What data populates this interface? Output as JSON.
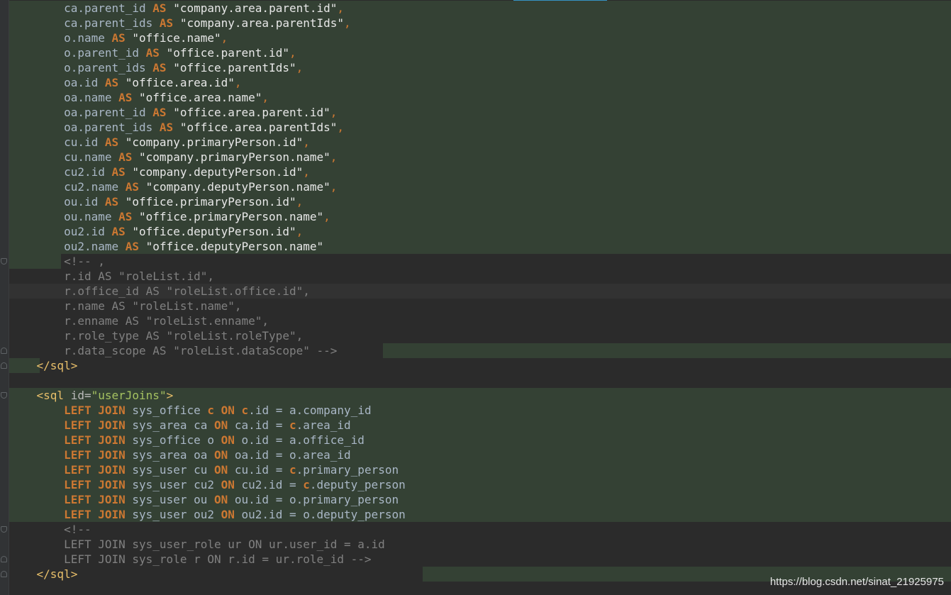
{
  "editor": {
    "lines": [
      {
        "segs": [
          [
            "id",
            "        ca.parent_id "
          ],
          [
            "kw",
            "AS"
          ],
          [
            "id",
            " "
          ],
          [
            "str",
            "\"company.area.parent.id\""
          ],
          [
            "comma",
            ","
          ]
        ]
      },
      {
        "segs": [
          [
            "id",
            "        ca.parent_ids "
          ],
          [
            "kw",
            "AS"
          ],
          [
            "id",
            " "
          ],
          [
            "str",
            "\"company.area.parentIds\""
          ],
          [
            "comma",
            ","
          ]
        ]
      },
      {
        "segs": [
          [
            "id",
            "        o.name "
          ],
          [
            "kw",
            "AS"
          ],
          [
            "id",
            " "
          ],
          [
            "str",
            "\"office.name\""
          ],
          [
            "comma",
            ","
          ]
        ]
      },
      {
        "segs": [
          [
            "id",
            "        o.parent_id "
          ],
          [
            "kw",
            "AS"
          ],
          [
            "id",
            " "
          ],
          [
            "str",
            "\"office.parent.id\""
          ],
          [
            "comma",
            ","
          ]
        ]
      },
      {
        "segs": [
          [
            "id",
            "        o.parent_ids "
          ],
          [
            "kw",
            "AS"
          ],
          [
            "id",
            " "
          ],
          [
            "str",
            "\"office.parentIds\""
          ],
          [
            "comma",
            ","
          ]
        ]
      },
      {
        "segs": [
          [
            "id",
            "        oa.id "
          ],
          [
            "kw",
            "AS"
          ],
          [
            "id",
            " "
          ],
          [
            "str",
            "\"office.area.id\""
          ],
          [
            "comma",
            ","
          ]
        ]
      },
      {
        "segs": [
          [
            "id",
            "        oa.name "
          ],
          [
            "kw",
            "AS"
          ],
          [
            "id",
            " "
          ],
          [
            "str",
            "\"office.area.name\""
          ],
          [
            "comma",
            ","
          ]
        ]
      },
      {
        "segs": [
          [
            "id",
            "        oa.parent_id "
          ],
          [
            "kw",
            "AS"
          ],
          [
            "id",
            " "
          ],
          [
            "str",
            "\"office.area.parent.id\""
          ],
          [
            "comma",
            ","
          ]
        ]
      },
      {
        "segs": [
          [
            "id",
            "        oa.parent_ids "
          ],
          [
            "kw",
            "AS"
          ],
          [
            "id",
            " "
          ],
          [
            "str",
            "\"office.area.parentIds\""
          ],
          [
            "comma",
            ","
          ]
        ]
      },
      {
        "segs": [
          [
            "id",
            "        cu.id "
          ],
          [
            "kw",
            "AS"
          ],
          [
            "id",
            " "
          ],
          [
            "str",
            "\"company.primaryPerson.id\""
          ],
          [
            "comma",
            ","
          ]
        ]
      },
      {
        "segs": [
          [
            "id",
            "        cu.name "
          ],
          [
            "kw",
            "AS"
          ],
          [
            "id",
            " "
          ],
          [
            "str",
            "\"company.primaryPerson.name\""
          ],
          [
            "comma",
            ","
          ]
        ]
      },
      {
        "segs": [
          [
            "id",
            "        cu2.id "
          ],
          [
            "kw",
            "AS"
          ],
          [
            "id",
            " "
          ],
          [
            "str",
            "\"company.deputyPerson.id\""
          ],
          [
            "comma",
            ","
          ]
        ]
      },
      {
        "segs": [
          [
            "id",
            "        cu2.name "
          ],
          [
            "kw",
            "AS"
          ],
          [
            "id",
            " "
          ],
          [
            "str",
            "\"company.deputyPerson.name\""
          ],
          [
            "comma",
            ","
          ]
        ]
      },
      {
        "segs": [
          [
            "id",
            "        ou.id "
          ],
          [
            "kw",
            "AS"
          ],
          [
            "id",
            " "
          ],
          [
            "str",
            "\"office.primaryPerson.id\""
          ],
          [
            "comma",
            ","
          ]
        ]
      },
      {
        "segs": [
          [
            "id",
            "        ou.name "
          ],
          [
            "kw",
            "AS"
          ],
          [
            "id",
            " "
          ],
          [
            "str",
            "\"office.primaryPerson.name\""
          ],
          [
            "comma",
            ","
          ]
        ]
      },
      {
        "segs": [
          [
            "id",
            "        ou2.id "
          ],
          [
            "kw",
            "AS"
          ],
          [
            "id",
            " "
          ],
          [
            "str",
            "\"office.deputyPerson.id\""
          ],
          [
            "comma",
            ","
          ]
        ]
      },
      {
        "segs": [
          [
            "id",
            "        ou2.name "
          ],
          [
            "kw",
            "AS"
          ],
          [
            "id",
            " "
          ],
          [
            "str",
            "\"office.deputyPerson.name\""
          ]
        ]
      },
      {
        "segs": [
          [
            "comment",
            "        <!-- ,"
          ]
        ]
      },
      {
        "segs": [
          [
            "comment",
            "        r.id AS \"roleList.id\","
          ]
        ]
      },
      {
        "segs": [
          [
            "comment",
            "        r.office_id AS \"roleList.office.id\","
          ]
        ]
      },
      {
        "segs": [
          [
            "comment",
            "        r.name AS \"roleList.name\","
          ]
        ]
      },
      {
        "segs": [
          [
            "comment",
            "        r.enname AS \"roleList.enname\","
          ]
        ]
      },
      {
        "segs": [
          [
            "comment",
            "        r.role_type AS \"roleList.roleType\","
          ]
        ]
      },
      {
        "segs": [
          [
            "comment",
            "        r.data_scope AS \"roleList.dataScope\" -->"
          ]
        ]
      },
      {
        "segs": [
          [
            "id",
            "    "
          ],
          [
            "tag",
            "</sql>"
          ]
        ]
      },
      {
        "segs": []
      },
      {
        "segs": [
          [
            "id",
            "    "
          ],
          [
            "tag",
            "<sql "
          ],
          [
            "attr",
            "id="
          ],
          [
            "attrval",
            "\"userJoins\""
          ],
          [
            "tag",
            ">"
          ]
        ]
      },
      {
        "segs": [
          [
            "id",
            "        "
          ],
          [
            "kw",
            "LEFT JOIN"
          ],
          [
            "id",
            " sys_office "
          ],
          [
            "kw",
            "c"
          ],
          [
            "id",
            " "
          ],
          [
            "kw",
            "ON"
          ],
          [
            "id",
            " "
          ],
          [
            "kw",
            "c"
          ],
          [
            "id",
            ".id = a.company_id"
          ]
        ]
      },
      {
        "segs": [
          [
            "id",
            "        "
          ],
          [
            "kw",
            "LEFT JOIN"
          ],
          [
            "id",
            " sys_area ca "
          ],
          [
            "kw",
            "ON"
          ],
          [
            "id",
            " ca.id = "
          ],
          [
            "kw",
            "c"
          ],
          [
            "id",
            ".area_id"
          ]
        ]
      },
      {
        "segs": [
          [
            "id",
            "        "
          ],
          [
            "kw",
            "LEFT JOIN"
          ],
          [
            "id",
            " sys_office o "
          ],
          [
            "kw",
            "ON"
          ],
          [
            "id",
            " o.id = a.office_id"
          ]
        ]
      },
      {
        "segs": [
          [
            "id",
            "        "
          ],
          [
            "kw",
            "LEFT JOIN"
          ],
          [
            "id",
            " sys_area oa "
          ],
          [
            "kw",
            "ON"
          ],
          [
            "id",
            " oa.id = o.area_id"
          ]
        ]
      },
      {
        "segs": [
          [
            "id",
            "        "
          ],
          [
            "kw",
            "LEFT JOIN"
          ],
          [
            "id",
            " sys_user cu "
          ],
          [
            "kw",
            "ON"
          ],
          [
            "id",
            " cu.id = "
          ],
          [
            "kw",
            "c"
          ],
          [
            "id",
            ".primary_person"
          ]
        ]
      },
      {
        "segs": [
          [
            "id",
            "        "
          ],
          [
            "kw",
            "LEFT JOIN"
          ],
          [
            "id",
            " sys_user cu2 "
          ],
          [
            "kw",
            "ON"
          ],
          [
            "id",
            " cu2.id = "
          ],
          [
            "kw",
            "c"
          ],
          [
            "id",
            ".deputy_person"
          ]
        ]
      },
      {
        "segs": [
          [
            "id",
            "        "
          ],
          [
            "kw",
            "LEFT JOIN"
          ],
          [
            "id",
            " sys_user ou "
          ],
          [
            "kw",
            "ON"
          ],
          [
            "id",
            " ou.id = o.primary_person"
          ]
        ]
      },
      {
        "segs": [
          [
            "id",
            "        "
          ],
          [
            "kw",
            "LEFT JOIN"
          ],
          [
            "id",
            " sys_user ou2 "
          ],
          [
            "kw",
            "ON"
          ],
          [
            "id",
            " ou2.id = o.deputy_person"
          ]
        ]
      },
      {
        "segs": [
          [
            "comment",
            "        <!--"
          ]
        ]
      },
      {
        "segs": [
          [
            "comment",
            "        LEFT JOIN sys_user_role ur ON ur.user_id = a.id"
          ]
        ]
      },
      {
        "segs": [
          [
            "comment",
            "        LEFT JOIN sys_role r ON r.id = ur.role_id -->"
          ]
        ]
      },
      {
        "segs": [
          [
            "id",
            "    "
          ],
          [
            "tag",
            "</sql>"
          ]
        ]
      }
    ]
  },
  "watermark": "https://blog.csdn.net/sinat_21925975"
}
